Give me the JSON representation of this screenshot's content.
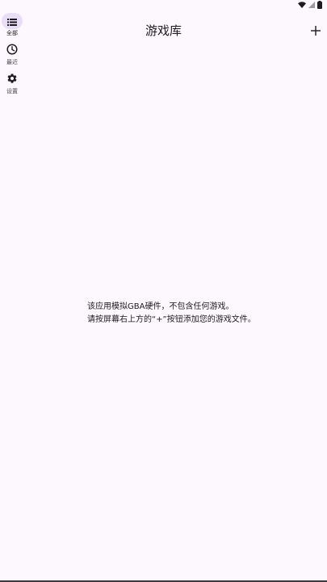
{
  "app": {
    "title": "游戏库"
  },
  "nav": {
    "items": [
      {
        "label": "全部",
        "icon": "list-icon",
        "active": true
      },
      {
        "label": "最近",
        "icon": "clock-icon",
        "active": false
      },
      {
        "label": "设置",
        "icon": "gear-icon",
        "active": false
      }
    ]
  },
  "toolbar": {
    "add_label": "+"
  },
  "empty_state": {
    "line1": "该应用模拟GBA硬件，不包含任何游戏。",
    "line2": "请按屏幕右上方的“+”按钮添加您的游戏文件。"
  },
  "colors": {
    "background": "#fdf7fe",
    "active_indicator": "#e8def8",
    "text": "#1d1b20"
  }
}
